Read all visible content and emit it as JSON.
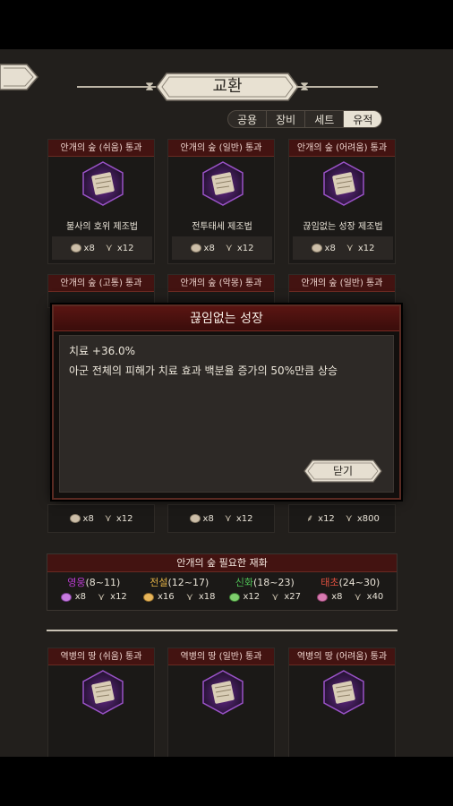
{
  "title": "교환",
  "tabs": [
    "공용",
    "장비",
    "세트",
    "유적"
  ],
  "active_tab": "유적",
  "colors": {
    "card_header": "#431311",
    "rarity_hero": "#b93ccf",
    "rarity_legend": "#e0b046",
    "rarity_myth": "#4fbf55",
    "rarity_primal": "#e05040"
  },
  "cards_row1": [
    {
      "header": "안개의 숲 (쉬움) 통과",
      "name": "불사의 호위 제조법",
      "cost1": "x8",
      "cost2": "x12",
      "icon": "scroll-icon"
    },
    {
      "header": "안개의 숲 (일반) 통과",
      "name": "전투태세 제조법",
      "cost1": "x8",
      "cost2": "x12",
      "icon": "scroll-icon"
    },
    {
      "header": "안개의 숲 (어려움) 통과",
      "name": "끊임없는 성장 제조법",
      "cost1": "x8",
      "cost2": "x12",
      "icon": "scroll-icon"
    }
  ],
  "cards_row2": [
    {
      "header": "안개의 숲 (고통) 통과",
      "cost1": "x8",
      "cost2": "x12"
    },
    {
      "header": "안개의 숲 (악몽) 통과",
      "cost1": "x8",
      "cost2": "x12"
    },
    {
      "header": "안개의 숲 (일반) 통과",
      "cost1": "x12",
      "cost2": "x800"
    }
  ],
  "requirements": {
    "title": "안개의 숲 필요한 재화",
    "tiers": [
      {
        "rarity": "영웅",
        "range": "(8~11)",
        "c1": "x8",
        "c2": "x12"
      },
      {
        "rarity": "전설",
        "range": "(12~17)",
        "c1": "x16",
        "c2": "x18"
      },
      {
        "rarity": "신화",
        "range": "(18~23)",
        "c1": "x12",
        "c2": "x27"
      },
      {
        "rarity": "태초",
        "range": "(24~30)",
        "c1": "x8",
        "c2": "x40"
      }
    ]
  },
  "cards_row3": [
    {
      "header": "역병의 땅 (쉬움) 통과"
    },
    {
      "header": "역병의 땅 (일반) 통과"
    },
    {
      "header": "역병의 땅 (어려움) 통과"
    }
  ],
  "modal": {
    "title": "끊임없는 성장",
    "line1": "치료 +36.0%",
    "line2": "아군 전체의 피해가 치료 효과 백분율 증가의 50%만큼 상승",
    "close_label": "닫기"
  }
}
